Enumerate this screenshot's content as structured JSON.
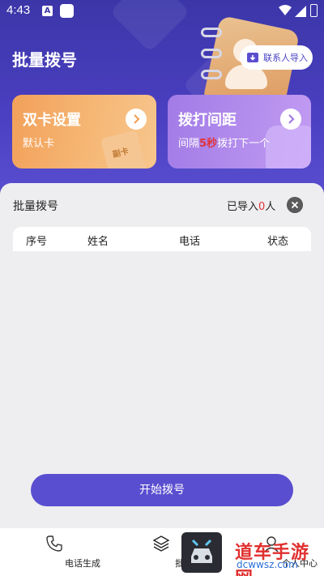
{
  "status_bar": {
    "time": "4:43",
    "notif_icon_letter": "A"
  },
  "header": {
    "title": "批量拨号",
    "import_button": "联系人导入"
  },
  "cards": {
    "dual_sim": {
      "title": "双卡设置",
      "subtitle": "默认卡",
      "sim_label": "副卡"
    },
    "interval": {
      "title": "拨打间距",
      "sub_prefix": "间隔",
      "seconds": "5秒",
      "sub_suffix": "拨打下一个"
    }
  },
  "list": {
    "title": "批量拨号",
    "imported_prefix": "已导入",
    "imported_count": "0",
    "imported_suffix": "人",
    "columns": [
      "序号",
      "姓名",
      "电话",
      "状态"
    ],
    "rows": []
  },
  "start_button": "开始拨号",
  "tabs": [
    {
      "label": "电话生成",
      "icon": "phone-icon",
      "active": false
    },
    {
      "label": "批量拨号",
      "icon": "layers-icon",
      "active": true
    },
    {
      "label": "个人中心",
      "icon": "person-icon",
      "active": false
    }
  ],
  "watermark": {
    "text": "道车手游网",
    "url": "dcwwsz.com"
  },
  "colors": {
    "primary": "#5a4ed0",
    "hero": "#3b36a8",
    "accent_red": "#e2343c",
    "card_orange": "#f2a15a",
    "card_purple": "#a27be6"
  }
}
